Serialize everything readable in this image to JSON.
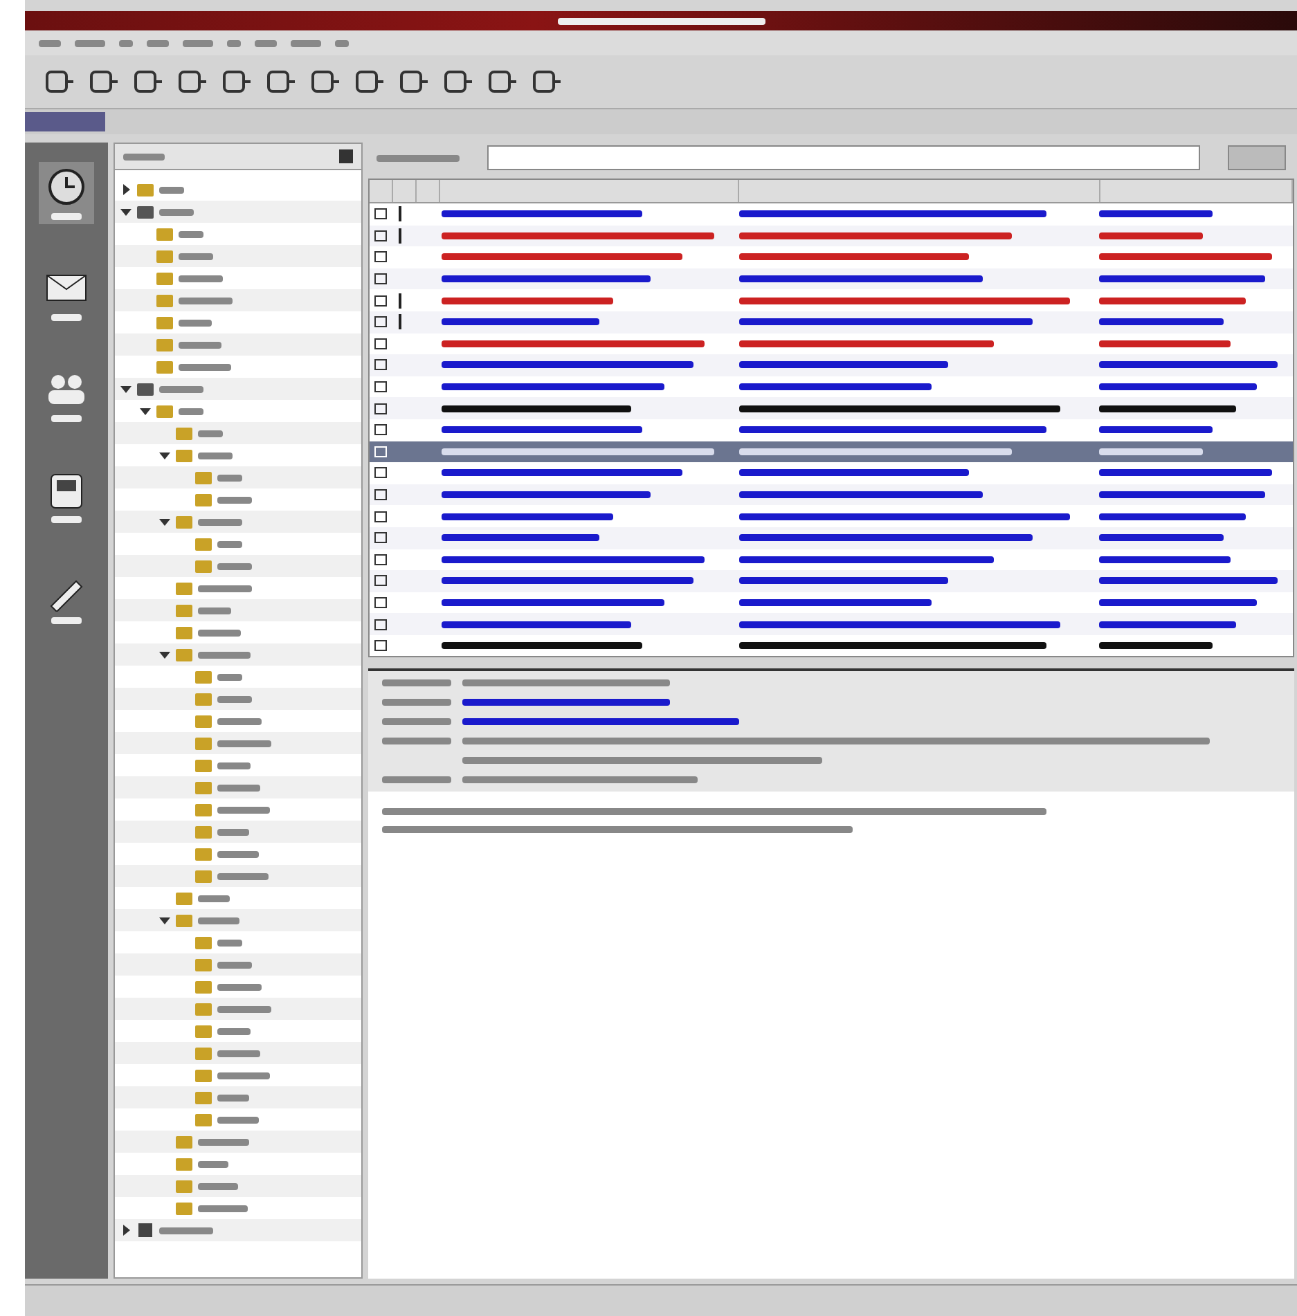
{
  "sidebar": {
    "items": [
      {
        "kind": "clock",
        "selected": true
      },
      {
        "kind": "mail",
        "selected": false
      },
      {
        "kind": "people",
        "selected": false
      },
      {
        "kind": "phone",
        "selected": false
      },
      {
        "kind": "pen",
        "selected": false
      }
    ]
  },
  "folders": [
    {
      "kind": "folder",
      "expanded": false
    },
    {
      "kind": "server",
      "expanded": true,
      "children": [
        {
          "kind": "folder"
        },
        {
          "kind": "folder"
        },
        {
          "kind": "folder"
        },
        {
          "kind": "folder"
        },
        {
          "kind": "folder"
        },
        {
          "kind": "folder"
        },
        {
          "kind": "folder"
        }
      ]
    },
    {
      "kind": "server",
      "expanded": true,
      "children": [
        {
          "kind": "folder",
          "expanded": true,
          "children": [
            {
              "kind": "folder"
            },
            {
              "kind": "folder",
              "expanded": true,
              "children": [
                {
                  "kind": "folder"
                },
                {
                  "kind": "folder"
                }
              ]
            },
            {
              "kind": "folder",
              "expanded": true,
              "children": [
                {
                  "kind": "folder"
                },
                {
                  "kind": "folder"
                }
              ]
            },
            {
              "kind": "folder"
            },
            {
              "kind": "folder"
            },
            {
              "kind": "folder"
            },
            {
              "kind": "folder",
              "expanded": true,
              "children": [
                {
                  "kind": "folder"
                },
                {
                  "kind": "folder"
                },
                {
                  "kind": "folder"
                },
                {
                  "kind": "folder"
                },
                {
                  "kind": "folder"
                },
                {
                  "kind": "folder"
                },
                {
                  "kind": "folder"
                },
                {
                  "kind": "folder"
                },
                {
                  "kind": "folder"
                },
                {
                  "kind": "folder"
                }
              ]
            },
            {
              "kind": "folder"
            },
            {
              "kind": "folder",
              "expanded": true,
              "children": [
                {
                  "kind": "folder"
                },
                {
                  "kind": "folder"
                },
                {
                  "kind": "folder"
                },
                {
                  "kind": "folder"
                },
                {
                  "kind": "folder"
                },
                {
                  "kind": "folder"
                },
                {
                  "kind": "folder"
                },
                {
                  "kind": "folder"
                },
                {
                  "kind": "folder"
                }
              ]
            },
            {
              "kind": "folder"
            },
            {
              "kind": "folder"
            },
            {
              "kind": "folder"
            },
            {
              "kind": "folder"
            }
          ]
        }
      ]
    },
    {
      "kind": "trash",
      "expanded": false
    }
  ],
  "messages": [
    {
      "color": "#1a1acc",
      "flagged": true,
      "selected": false
    },
    {
      "color": "#cc2222",
      "flagged": true,
      "selected": false
    },
    {
      "color": "#cc2222",
      "flagged": false,
      "selected": false
    },
    {
      "color": "#1a1acc",
      "flagged": false,
      "selected": false
    },
    {
      "color": "#cc2222",
      "flagged": true,
      "selected": false
    },
    {
      "color": "#1a1acc",
      "flagged": true,
      "selected": false
    },
    {
      "color": "#cc2222",
      "flagged": false,
      "selected": false
    },
    {
      "color": "#1a1acc",
      "flagged": false,
      "selected": false
    },
    {
      "color": "#1a1acc",
      "flagged": false,
      "selected": false
    },
    {
      "color": "#111111",
      "flagged": false,
      "selected": false
    },
    {
      "color": "#1a1acc",
      "flagged": false,
      "selected": false
    },
    {
      "color": "#d8dcec",
      "flagged": false,
      "selected": true
    },
    {
      "color": "#1a1acc",
      "flagged": false,
      "selected": false
    },
    {
      "color": "#1a1acc",
      "flagged": false,
      "selected": false
    },
    {
      "color": "#1a1acc",
      "flagged": false,
      "selected": false
    },
    {
      "color": "#1a1acc",
      "flagged": false,
      "selected": false
    },
    {
      "color": "#1a1acc",
      "flagged": false,
      "selected": false
    },
    {
      "color": "#1a1acc",
      "flagged": false,
      "selected": false
    },
    {
      "color": "#1a1acc",
      "flagged": false,
      "selected": false
    },
    {
      "color": "#1a1acc",
      "flagged": false,
      "selected": false
    },
    {
      "color": "#111111",
      "flagged": false,
      "selected": false
    }
  ]
}
